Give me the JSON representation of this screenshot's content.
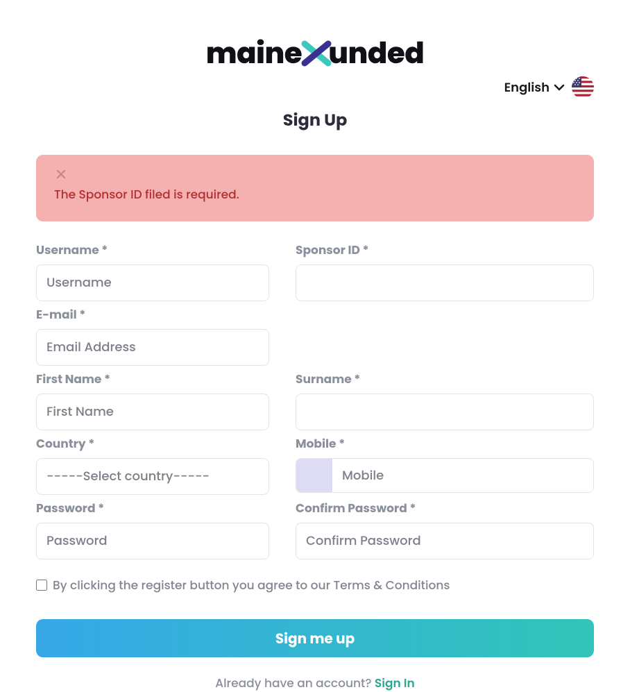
{
  "logo": {
    "part1": "maine",
    "part2": "unded"
  },
  "language": {
    "label": "English"
  },
  "page_title": "Sign Up",
  "alert": {
    "message": "The Sponsor ID filed is required."
  },
  "form": {
    "username": {
      "label": "Username *",
      "placeholder": "Username",
      "value": ""
    },
    "sponsor_id": {
      "label": "Sponsor ID *",
      "placeholder": "",
      "value": ""
    },
    "email": {
      "label": "E-mail *",
      "placeholder": "Email Address",
      "value": ""
    },
    "first_name": {
      "label": "First Name *",
      "placeholder": "First Name",
      "value": ""
    },
    "surname": {
      "label": "Surname *",
      "placeholder": "",
      "value": ""
    },
    "country": {
      "label": "Country *",
      "placeholder": "-----Select country-----"
    },
    "mobile": {
      "label": "Mobile *",
      "placeholder": "Mobile",
      "value": ""
    },
    "password": {
      "label": "Password *",
      "placeholder": "Password",
      "value": ""
    },
    "confirm_password": {
      "label": "Confirm Password *",
      "placeholder": "Confirm Password",
      "value": ""
    }
  },
  "terms": {
    "text": "By clicking the register button you agree to our Terms & Conditions"
  },
  "submit": {
    "label": "Sign me up"
  },
  "signin": {
    "prompt": "Already have an account? ",
    "link": "Sign In"
  }
}
